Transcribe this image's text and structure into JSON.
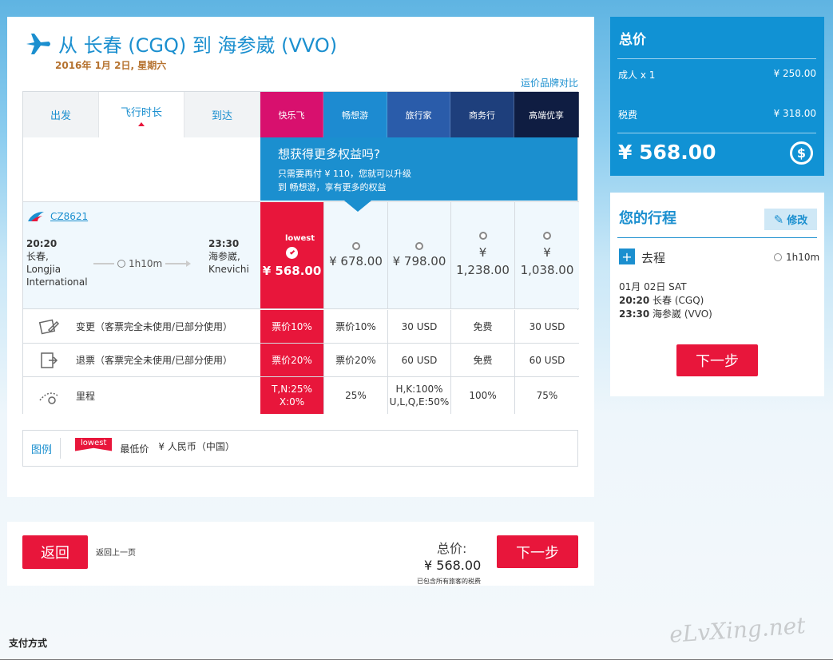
{
  "header": {
    "title": "从 长春 (CGQ) 到 海参崴 (VVO)",
    "date": "2016年 1月 2日, 星期六",
    "compare_link": "运价品牌对比"
  },
  "sort_tabs": [
    "出发",
    "飞行时长",
    "到达"
  ],
  "fare_brands": [
    {
      "name": "快乐飞",
      "color": "#d8106e"
    },
    {
      "name": "畅想游",
      "color": "#1d8bd1"
    },
    {
      "name": "旅行家",
      "color": "#2a5caa"
    },
    {
      "name": "商务行",
      "color": "#1e3f7c"
    },
    {
      "name": "高端优享",
      "color": "#0f1d42"
    }
  ],
  "promo": {
    "heading": "想获得更多权益吗?",
    "line1": "只需要再付 ¥ 110，您就可以升级",
    "line2": "到 畅想游，享有更多的权益"
  },
  "flight": {
    "number": "CZ8621",
    "dep_time": "20:20",
    "dep_city": "长春,",
    "dep_airport_1": "Longjia",
    "dep_airport_2": "International",
    "duration": "1h10m",
    "arr_time": "23:30",
    "arr_city": "海参崴,",
    "arr_airport": "Knevichi",
    "lowest_tag": "lowest",
    "prices": [
      "¥ 568.00",
      "¥ 678.00",
      "¥ 798.00",
      "¥\n1,238.00",
      "¥\n1,038.00"
    ]
  },
  "rules": [
    {
      "label": "变更（客票完全未使用/已部分使用）",
      "values": [
        "票价10%",
        "票价10%",
        "30 USD",
        "免费",
        "30 USD"
      ]
    },
    {
      "label": "退票（客票完全未使用/已部分使用）",
      "values": [
        "票价20%",
        "票价20%",
        "60 USD",
        "免费",
        "60 USD"
      ]
    },
    {
      "label": "里程",
      "values": [
        "T,N:25%\nX:0%",
        "25%",
        "H,K:100%\nU,L,Q,E:50%",
        "100%",
        "75%"
      ]
    }
  ],
  "legend": {
    "title": "图例",
    "tag": "lowest",
    "tag_desc": "最低价",
    "currency": "¥  人民币（中国）"
  },
  "bottom": {
    "back_button": "返回",
    "back_desc": "返回上一页",
    "total_label": "总价:",
    "total_value": "¥ 568.00",
    "total_note": "已包含所有旅客的税费",
    "next_button": "下一步"
  },
  "summary": {
    "title": "总价",
    "adult_label": "成人 x 1",
    "adult_value": "¥ 250.00",
    "tax_label": "税费",
    "tax_value": "¥ 318.00",
    "total": "¥ 568.00"
  },
  "itinerary": {
    "title": "您的行程",
    "edit": "修改",
    "leg_label": "去程",
    "duration": "1h10m",
    "date": "01月 02日 SAT",
    "dep_time": "20:20",
    "dep": "长春 (CGQ)",
    "arr_time": "23:30",
    "arr": "海参崴 (VVO)",
    "next_button": "下一步"
  },
  "footer": {
    "label": "支付方式"
  },
  "watermark": "eLvXing.net"
}
